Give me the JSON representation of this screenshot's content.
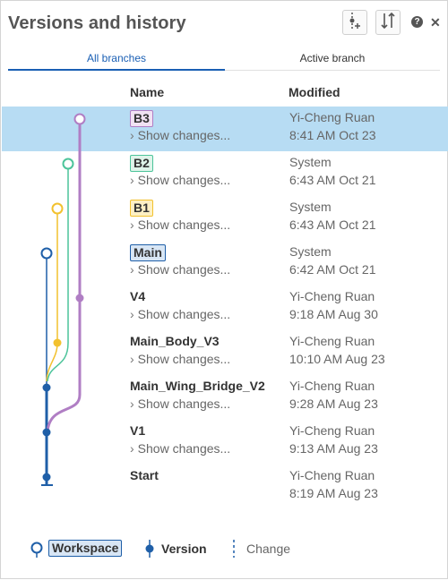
{
  "header": {
    "title": "Versions and history",
    "buttons": [
      {
        "icon": "create-version-icon"
      },
      {
        "icon": "branch-compare-icon"
      }
    ],
    "help_icon": "help-icon",
    "close_icon": "close-icon",
    "help_glyph": "?",
    "close_glyph": "✕"
  },
  "tabs": [
    {
      "label": "All branches",
      "active": true
    },
    {
      "label": "Active branch",
      "active": false
    }
  ],
  "columns": {
    "name": "Name",
    "modified": "Modified"
  },
  "rows": [
    {
      "name": "B3",
      "badge": true,
      "show_changes": "Show changes...",
      "modified_by": "Yi-Cheng Ruan",
      "modified_at": "8:41 AM Oct 23",
      "selected": true
    },
    {
      "name": "B2",
      "badge": true,
      "show_changes": "Show changes...",
      "modified_by": "System",
      "modified_at": "6:43 AM Oct 21"
    },
    {
      "name": "B1",
      "badge": true,
      "show_changes": "Show changes...",
      "modified_by": "System",
      "modified_at": "6:43 AM Oct 21"
    },
    {
      "name": "Main",
      "badge": true,
      "show_changes": "Show changes...",
      "modified_by": "System",
      "modified_at": "6:42 AM Oct 21"
    },
    {
      "name": "V4",
      "badge": false,
      "show_changes": "Show changes...",
      "modified_by": "Yi-Cheng Ruan",
      "modified_at": "9:18 AM Aug 30"
    },
    {
      "name": "Main_Body_V3",
      "badge": false,
      "show_changes": "Show changes...",
      "modified_by": "Yi-Cheng Ruan",
      "modified_at": "10:10 AM Aug 23"
    },
    {
      "name": "Main_Wing_Bridge_V2",
      "badge": false,
      "show_changes": "Show changes...",
      "modified_by": "Yi-Cheng Ruan",
      "modified_at": "9:28 AM Aug 23"
    },
    {
      "name": "V1",
      "badge": false,
      "show_changes": "Show changes...",
      "modified_by": "Yi-Cheng Ruan",
      "modified_at": "9:13 AM Aug 23"
    },
    {
      "name": "Start",
      "badge": false,
      "show_changes": "",
      "modified_by": "Yi-Cheng Ruan",
      "modified_at": "8:19 AM Aug 23"
    }
  ],
  "chevron": "›",
  "legend": {
    "workspace": "Workspace",
    "version": "Version",
    "change": "Change"
  },
  "colors": {
    "selected_row": "#b7dcf3",
    "tab_accent": "#1a5fb4",
    "branch_main": "#1f5fa8",
    "branch_b1": "#f2c12e",
    "branch_b2": "#4cc49a",
    "branch_b3": "#b07ec4",
    "badge_b3_bg": "#f1e2f3",
    "badge_b2_bg": "#dff4ea",
    "badge_b1_bg": "#fdf0c4",
    "badge_main_bg": "#d8e6f5"
  }
}
